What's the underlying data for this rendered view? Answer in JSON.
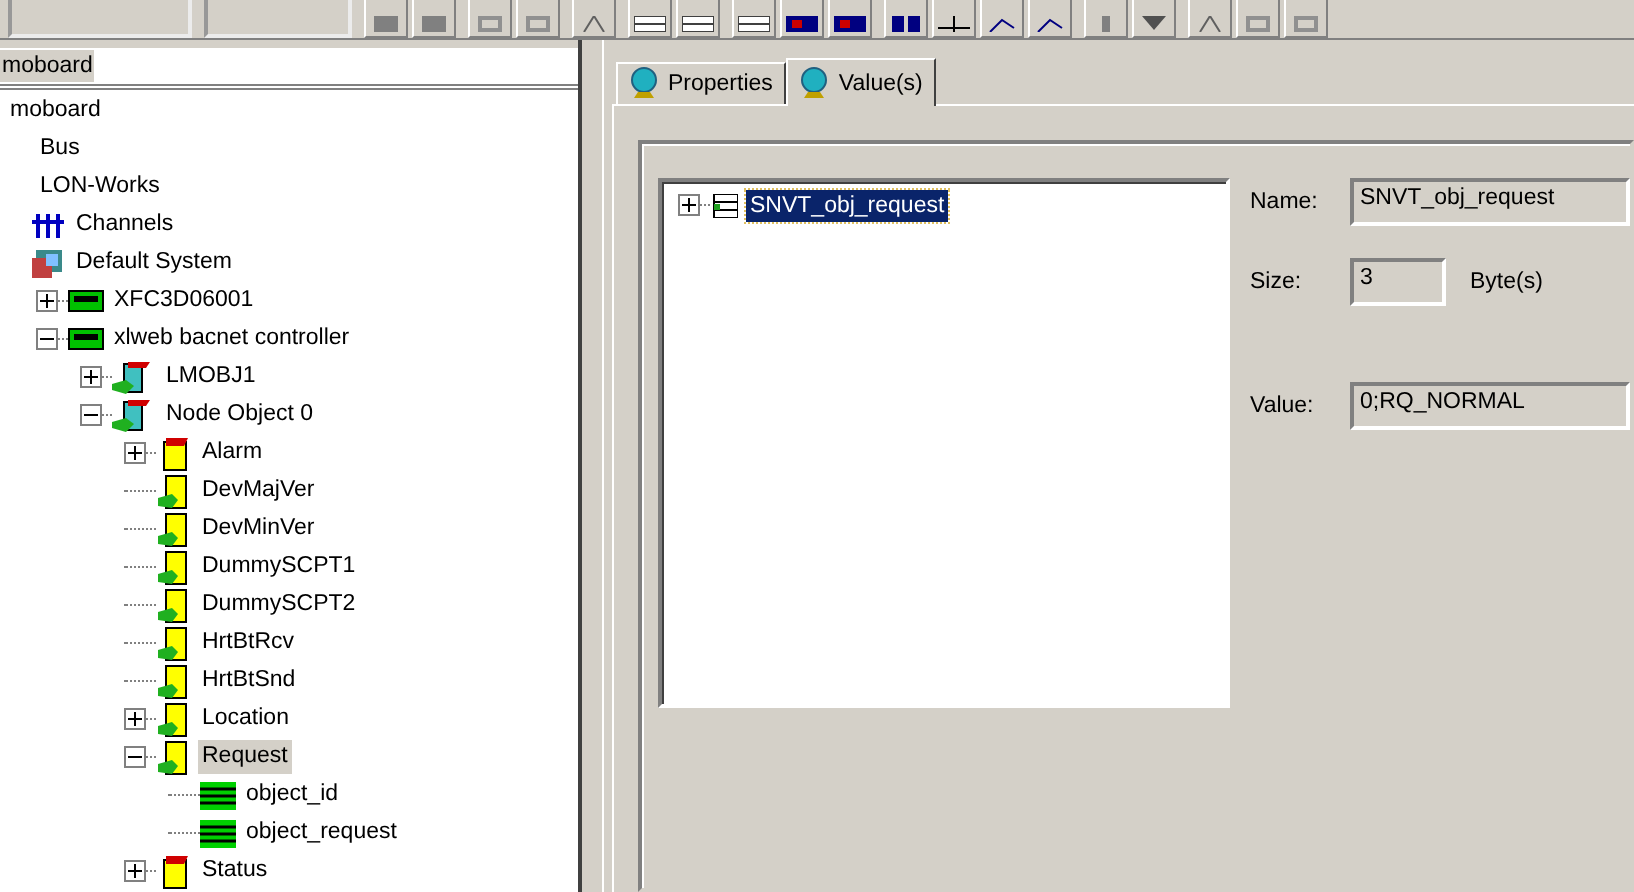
{
  "tree_header": {
    "value": "moboard"
  },
  "tree": [
    {
      "label": "moboard",
      "children": [
        {
          "label": "Bus"
        },
        {
          "label": "LON-Works"
        },
        {
          "label": "Channels",
          "kind": "channel"
        },
        {
          "label": "Default System",
          "kind": "system",
          "children": [
            {
              "label": "XFC3D06001",
              "kind": "device",
              "expanded": false
            },
            {
              "label": "xlweb bacnet controller",
              "kind": "device",
              "expanded": true,
              "children": [
                {
                  "label": "LMOBJ1",
                  "kind": "object",
                  "expanded": false
                },
                {
                  "label": "Node Object 0",
                  "kind": "object",
                  "expanded": true,
                  "children": [
                    {
                      "label": "Alarm",
                      "kind": "flag",
                      "expanded": false
                    },
                    {
                      "label": "DevMajVer",
                      "kind": "doc"
                    },
                    {
                      "label": "DevMinVer",
                      "kind": "doc"
                    },
                    {
                      "label": "DummySCPT1",
                      "kind": "doc"
                    },
                    {
                      "label": "DummySCPT2",
                      "kind": "doc"
                    },
                    {
                      "label": "HrtBtRcv",
                      "kind": "doc"
                    },
                    {
                      "label": "HrtBtSnd",
                      "kind": "doc"
                    },
                    {
                      "label": "Location",
                      "kind": "doc",
                      "expanded": false
                    },
                    {
                      "label": "Request",
                      "kind": "doc",
                      "expanded": true,
                      "selected": true,
                      "children": [
                        {
                          "label": "object_id",
                          "kind": "stripes"
                        },
                        {
                          "label": "object_request",
                          "kind": "stripes"
                        }
                      ]
                    },
                    {
                      "label": "Status",
                      "kind": "flag",
                      "expanded": false
                    }
                  ]
                }
              ]
            }
          ]
        }
      ]
    }
  ],
  "tabs": [
    {
      "label": "Properties",
      "selected": false
    },
    {
      "label": "Value(s)",
      "selected": true
    }
  ],
  "values_tree": [
    {
      "label": "SNVT_obj_request",
      "expanded": false,
      "selected": true
    }
  ],
  "fields": [
    {
      "label": "Name:",
      "value": "SNVT_obj_request",
      "kind": "wide"
    },
    {
      "label": "Size:",
      "value": "3",
      "unit": "Byte(s)",
      "kind": "short"
    },
    {
      "label": "Value:",
      "value": "0;RQ_NORMAL",
      "kind": "wide"
    }
  ]
}
